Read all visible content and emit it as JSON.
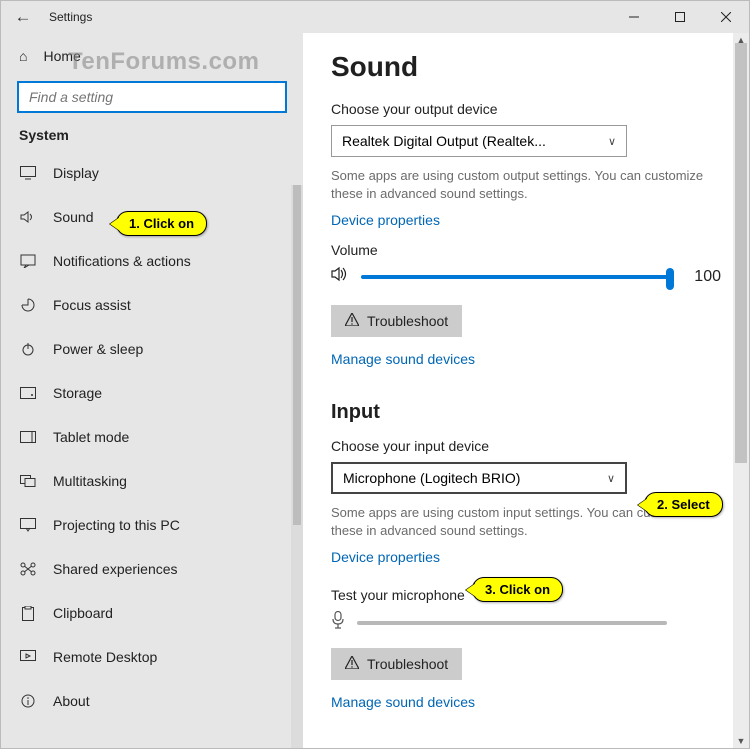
{
  "window": {
    "title": "Settings"
  },
  "watermark": "TenForums.com",
  "sidebar": {
    "home": "Home",
    "search_placeholder": "Find a setting",
    "group": "System",
    "items": [
      "Display",
      "Sound",
      "Notifications & actions",
      "Focus assist",
      "Power & sleep",
      "Storage",
      "Tablet mode",
      "Multitasking",
      "Projecting to this PC",
      "Shared experiences",
      "Clipboard",
      "Remote Desktop",
      "About"
    ]
  },
  "main": {
    "title": "Sound",
    "output_label": "Choose your output device",
    "output_device": "Realtek Digital Output (Realtek...",
    "output_desc": "Some apps are using custom output settings. You can customize these in advanced sound settings.",
    "device_props": "Device properties",
    "volume_label": "Volume",
    "volume_value": "100",
    "troubleshoot": "Troubleshoot",
    "manage": "Manage sound devices",
    "input_title": "Input",
    "input_label": "Choose your input device",
    "input_device": "Microphone (Logitech BRIO)",
    "input_desc": "Some apps are using custom input settings. You can customize these in advanced sound settings.",
    "test_label": "Test your microphone"
  },
  "callouts": {
    "c1": "1. Click on",
    "c2": "2. Select",
    "c3": "3. Click on"
  }
}
